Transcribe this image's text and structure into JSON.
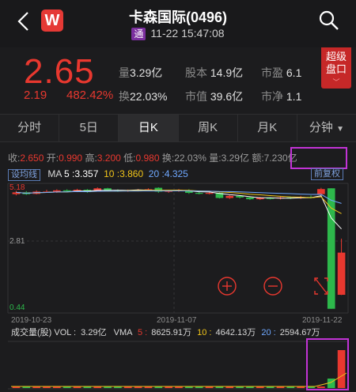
{
  "header": {
    "title": "卡森国际(0496)",
    "market_badge": "通",
    "datetime": "11-22 15:47:08",
    "logo_letter": "W"
  },
  "quote": {
    "price": "2.65",
    "change": "2.19",
    "change_pct": "482.42%",
    "stats": [
      {
        "k": "量",
        "v": "3.29亿"
      },
      {
        "k": "股本",
        "v": "14.9亿"
      },
      {
        "k": "市盈",
        "v": "6.1"
      },
      {
        "k": "换",
        "v": "22.03%"
      },
      {
        "k": "市值",
        "v": "39.6亿"
      },
      {
        "k": "市净",
        "v": "1.1"
      }
    ],
    "super_btn": [
      "超级",
      "盘口"
    ]
  },
  "tabs": [
    "分时",
    "5日",
    "日K",
    "周K",
    "月K",
    "分钟"
  ],
  "active_tab": "日K",
  "info": {
    "shou_k": "收:",
    "shou_v": "2.650",
    "kai_k": "开:",
    "kai_v": "0.990",
    "gao_k": "高:",
    "gao_v": "3.200",
    "di_k": "低:",
    "di_v": "0.980",
    "huan_k": "换:",
    "huan_v": "22.03%",
    "liang_k": "量:",
    "liang_v": "3.29亿",
    "e_k": "额:",
    "e_v": "7.230亿"
  },
  "ma": {
    "btn": "设均线",
    "label": "MA",
    "ma5_k": "5 :",
    "ma5_v": "3.357",
    "ma10_k": "10 :",
    "ma10_v": "3.860",
    "ma20_k": "20 :",
    "ma20_v": "4.325",
    "fq": "前复权"
  },
  "chart_data": {
    "type": "candlestick",
    "y_labels": [
      "5.18",
      "2.81",
      "0.44"
    ],
    "x_labels": [
      "2019-10-23",
      "2019-11-07",
      "2019-11-22"
    ],
    "vol_header": {
      "label": "成交量(股) VOL :",
      "vol": "3.29亿",
      "vma": "VMA",
      "v5_k": "5 :",
      "v5": "8625.91万",
      "v10_k": "10 :",
      "v10": "4642.13万",
      "v20_k": "20 :",
      "v20": "2594.67万"
    },
    "candles": [
      {
        "o": 4.95,
        "c": 5.02,
        "h": 5.08,
        "l": 4.9
      },
      {
        "o": 5.02,
        "c": 4.95,
        "h": 5.07,
        "l": 4.92
      },
      {
        "o": 4.96,
        "c": 5.05,
        "h": 5.1,
        "l": 4.94
      },
      {
        "o": 5.05,
        "c": 5.05,
        "h": 5.12,
        "l": 5.0
      },
      {
        "o": 5.03,
        "c": 5.1,
        "h": 5.14,
        "l": 5.0
      },
      {
        "o": 5.1,
        "c": 5.06,
        "h": 5.14,
        "l": 5.02
      },
      {
        "o": 5.06,
        "c": 5.12,
        "h": 5.16,
        "l": 5.03
      },
      {
        "o": 5.12,
        "c": 5.03,
        "h": 5.15,
        "l": 5.0
      },
      {
        "o": 5.08,
        "c": 5.18,
        "h": 5.22,
        "l": 5.05
      },
      {
        "o": 5.18,
        "c": 5.1,
        "h": 5.2,
        "l": 5.05
      },
      {
        "o": 5.1,
        "c": 5.08,
        "h": 5.14,
        "l": 5.04
      },
      {
        "o": 5.08,
        "c": 5.1,
        "h": 5.13,
        "l": 5.04
      },
      {
        "o": 5.1,
        "c": 5.12,
        "h": 5.15,
        "l": 5.06
      },
      {
        "o": 5.12,
        "c": 5.14,
        "h": 5.18,
        "l": 5.08
      },
      {
        "o": 5.2,
        "c": 5.05,
        "h": 5.22,
        "l": 5.0
      },
      {
        "o": 5.05,
        "c": 5.08,
        "h": 5.12,
        "l": 5.0
      },
      {
        "o": 5.08,
        "c": 5.12,
        "h": 5.15,
        "l": 5.04
      },
      {
        "o": 5.1,
        "c": 5.0,
        "h": 5.14,
        "l": 4.96
      },
      {
        "o": 5.0,
        "c": 4.98,
        "h": 5.05,
        "l": 4.94
      },
      {
        "o": 4.98,
        "c": 5.0,
        "h": 5.04,
        "l": 4.94
      },
      {
        "o": 5.0,
        "c": 4.8,
        "h": 5.02,
        "l": 4.78
      },
      {
        "o": 4.8,
        "c": 4.88,
        "h": 4.92,
        "l": 4.76
      },
      {
        "o": 4.88,
        "c": 4.82,
        "h": 4.9,
        "l": 4.78
      },
      {
        "o": 4.82,
        "c": 4.75,
        "h": 4.86,
        "l": 4.72
      },
      {
        "o": 4.75,
        "c": 4.8,
        "h": 4.84,
        "l": 4.72
      },
      {
        "o": 4.8,
        "c": 4.78,
        "h": 4.83,
        "l": 4.74
      },
      {
        "o": 4.78,
        "c": 4.82,
        "h": 4.86,
        "l": 4.74
      },
      {
        "o": 4.82,
        "c": 4.8,
        "h": 4.85,
        "l": 4.76
      },
      {
        "o": 4.8,
        "c": 4.84,
        "h": 4.88,
        "l": 4.76
      },
      {
        "o": 4.84,
        "c": 4.82,
        "h": 4.9,
        "l": 4.78
      },
      {
        "o": 4.95,
        "c": 5.15,
        "h": 5.2,
        "l": 4.9
      },
      {
        "o": 5.18,
        "c": 0.44,
        "h": 5.18,
        "l": 0.44
      },
      {
        "o": 0.99,
        "c": 2.65,
        "h": 3.2,
        "l": 0.98
      }
    ]
  },
  "colors": {
    "up": "#e8382f",
    "down": "#2db84b",
    "ma5": "#ffffff",
    "ma10": "#f0c419",
    "ma20": "#6fa8ff"
  }
}
